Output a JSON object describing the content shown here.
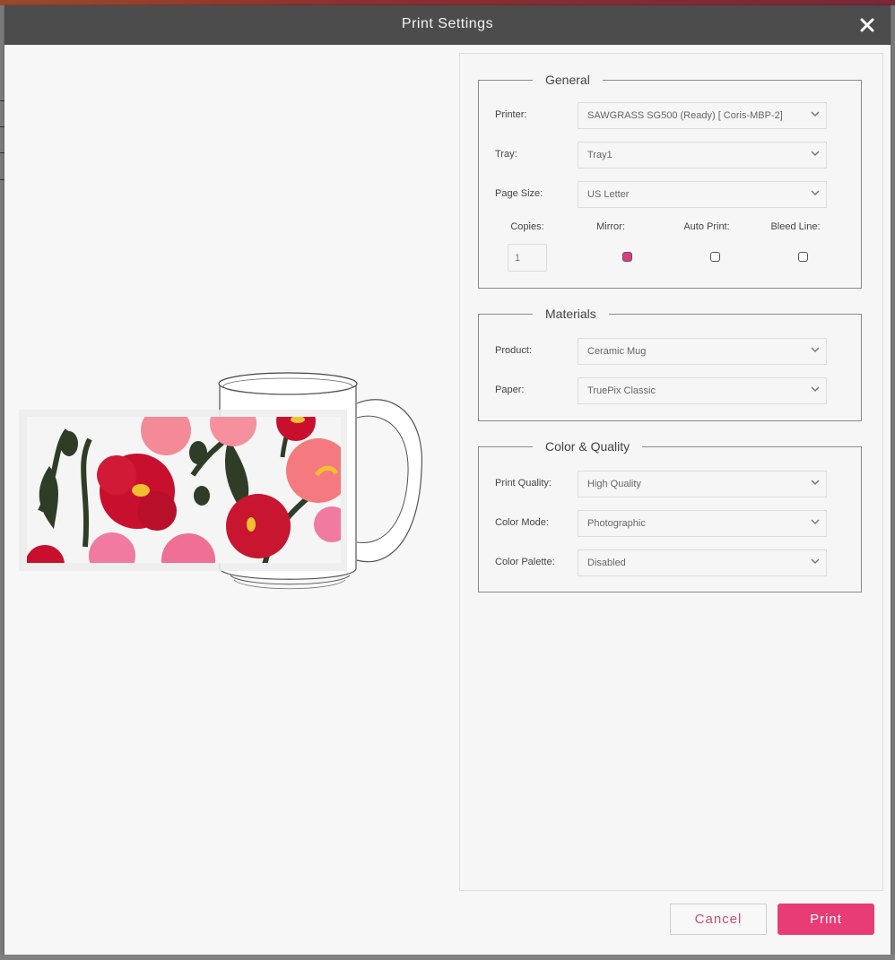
{
  "dialog": {
    "title": "Print Settings",
    "close_icon": "close-icon"
  },
  "preview": {
    "product": "Ceramic Mug",
    "design": "poppy floral pattern",
    "colors": {
      "red": "#c8102e",
      "pink": "#f07a8a",
      "leaf": "#2f3d26",
      "center": "#f0c030"
    }
  },
  "general": {
    "title": "General",
    "printer": {
      "label": "Printer:",
      "value": "SAWGRASS SG500 (Ready) [ Coris-MBP-2]"
    },
    "tray": {
      "label": "Tray:",
      "value": "Tray1"
    },
    "page_size": {
      "label": "Page Size:",
      "value": "US Letter"
    },
    "copies": {
      "label": "Copies:",
      "value": "1"
    },
    "mirror": {
      "label": "Mirror:",
      "checked": true
    },
    "auto_print": {
      "label": "Auto Print:",
      "checked": false
    },
    "bleed_line": {
      "label": "Bleed Line:",
      "checked": false
    }
  },
  "materials": {
    "title": "Materials",
    "product": {
      "label": "Product:",
      "value": "Ceramic Mug"
    },
    "paper": {
      "label": "Paper:",
      "value": "TruePix Classic"
    }
  },
  "color_quality": {
    "title": "Color & Quality",
    "print_quality": {
      "label": "Print Quality:",
      "value": "High Quality"
    },
    "color_mode": {
      "label": "Color Mode:",
      "value": "Photographic"
    },
    "color_palette": {
      "label": "Color Palette:",
      "value": "Disabled"
    }
  },
  "footer": {
    "cancel_label": "Cancel",
    "print_label": "Print"
  },
  "colors": {
    "accent": "#e83c76",
    "titlebar": "#4c4c4c"
  }
}
